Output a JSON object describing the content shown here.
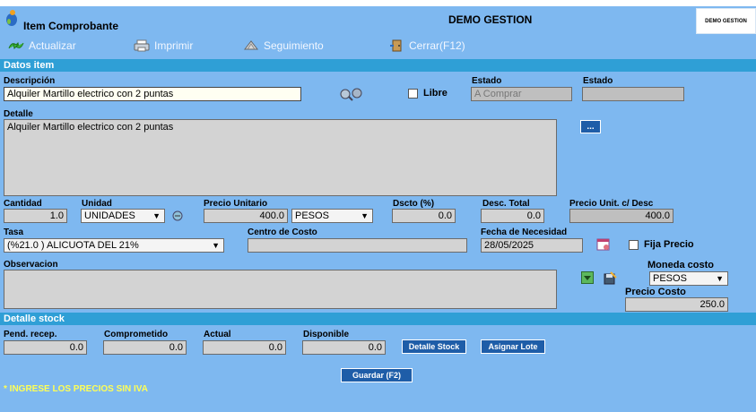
{
  "window": {
    "title": "Item Comprobante",
    "center_title": "DEMO GESTION",
    "logo_text": "DEMO GESTION"
  },
  "toolbar": {
    "actualizar": "Actualizar",
    "imprimir": "Imprimir",
    "seguimiento": "Seguimiento",
    "cerrar": "Cerrar(F12)"
  },
  "datos_item": {
    "section_title": "Datos item",
    "descripcion_label": "Descripción",
    "descripcion_value": "Alquiler Martillo electrico con 2 puntas",
    "libre_label": "Libre",
    "estado_label_1": "Estado",
    "estado_value_1": "A Comprar",
    "estado_label_2": "Estado",
    "estado_value_2": "",
    "detalle_label": "Detalle",
    "detalle_value": "Alquiler Martillo electrico con 2 puntas",
    "ellipsis_button": "...",
    "cantidad_label": "Cantidad",
    "cantidad_value": "1.0",
    "unidad_label": "Unidad",
    "unidad_value": "UNIDADES",
    "precio_unitario_label": "Precio Unitario",
    "precio_unitario_value": "400.0",
    "moneda_value": "PESOS",
    "dscto_label": "Dscto (%)",
    "dscto_value": "0.0",
    "desc_total_label": "Desc. Total",
    "desc_total_value": "0.0",
    "precio_unit_desc_label": "Precio Unit. c/ Desc",
    "precio_unit_desc_value": "400.0",
    "tasa_label": "Tasa",
    "tasa_value": "(%21.0 ) ALICUOTA DEL 21%",
    "centro_costo_label": "Centro de Costo",
    "centro_costo_value": "",
    "fecha_necesidad_label": "Fecha de Necesidad",
    "fecha_necesidad_value": "28/05/2025",
    "fija_precio_label": "Fija Precio",
    "observacion_label": "Observacion",
    "observacion_value": "",
    "moneda_costo_label": "Moneda costo",
    "moneda_costo_value": "PESOS",
    "precio_costo_label": "Precio Costo",
    "precio_costo_value": "250.0"
  },
  "detalle_stock": {
    "section_title": "Detalle stock",
    "pend_recep_label": "Pend. recep.",
    "pend_recep_value": "0.0",
    "comprometido_label": "Comprometido",
    "comprometido_value": "0.0",
    "actual_label": "Actual",
    "actual_value": "0.0",
    "disponible_label": "Disponible",
    "disponible_value": "0.0",
    "detalle_stock_button": "Detalle Stock",
    "asignar_lote_button": "Asignar Lote",
    "guardar_button": "Guardar (F2)",
    "note": "* INGRESE LOS PRECIOS SIN IVA"
  }
}
